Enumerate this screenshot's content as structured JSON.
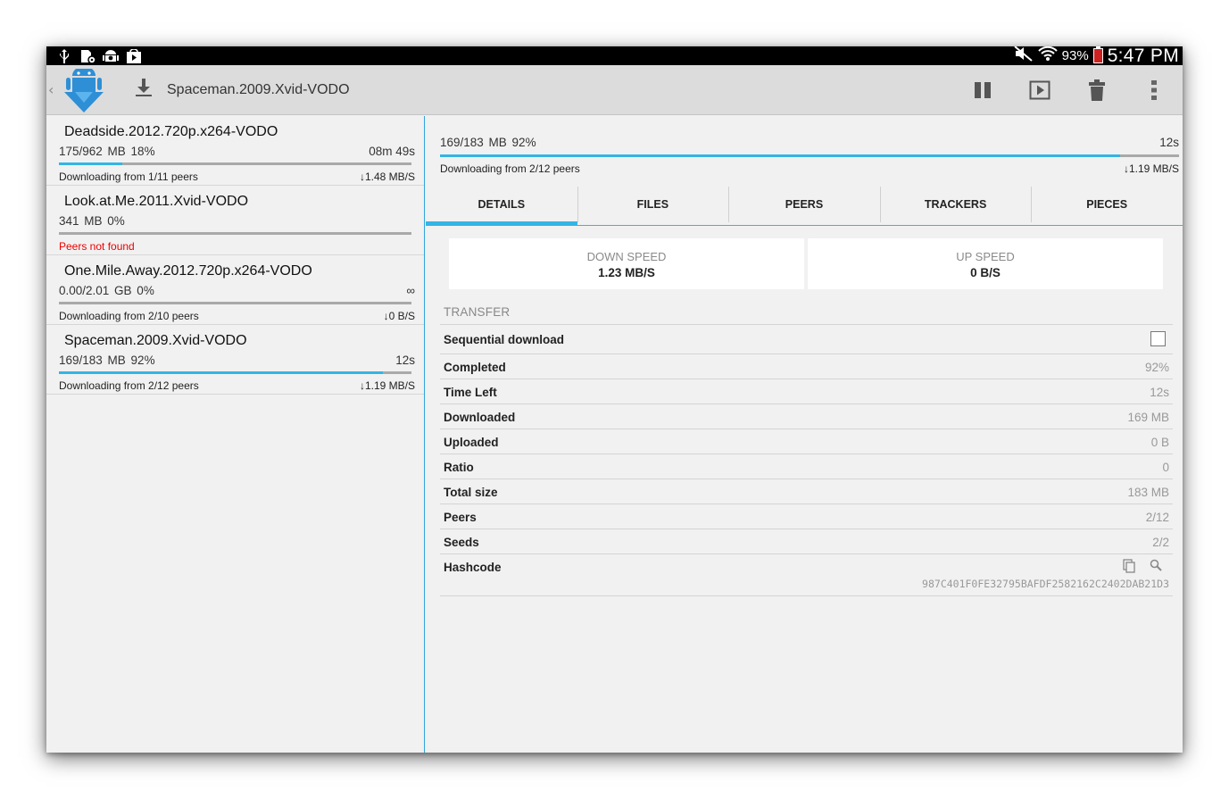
{
  "status_bar": {
    "battery": "93%",
    "time": "5:47 PM",
    "left_icons": [
      "usb-icon",
      "sd-card-icon",
      "android-debug-icon",
      "play-store-icon"
    ],
    "right_icons": [
      "mute-icon",
      "wifi-icon",
      "battery-icon"
    ]
  },
  "action_bar": {
    "title": "Spaceman.2009.Xvid-VODO",
    "actions": [
      "pause",
      "play",
      "delete",
      "overflow-menu"
    ]
  },
  "colors": {
    "accent": "#33b5e5",
    "error": "#ee0000",
    "action_bar": "#dcdcdc"
  },
  "torrents": [
    {
      "name": "Deadside.2012.720p.x264-VODO",
      "size": "175/962 MB   18%",
      "eta": "08m 49s",
      "progress": 0.18,
      "status": "Downloading from 1/11 peers",
      "speed": "1.48 MB/S"
    },
    {
      "name": "Look.at.Me.2011.Xvid-VODO",
      "size": "341 MB   0%",
      "eta": "",
      "progress": 0,
      "status": "Peers not found",
      "speed": ""
    },
    {
      "name": "One.Mile.Away.2012.720p.x264-VODO",
      "size": "0.00/2.01 GB   0%",
      "eta": "∞",
      "progress": 0,
      "status": "Downloading from 2/10 peers",
      "speed": "0 B/S"
    },
    {
      "name": "Spaceman.2009.Xvid-VODO",
      "size": "169/183 MB   92%",
      "eta": "12s",
      "progress": 0.92,
      "status": "Downloading from 2/12 peers",
      "speed": "1.19 MB/S"
    }
  ],
  "detail": {
    "size": "169/183 MB   92%",
    "eta": "12s",
    "progress": 0.92,
    "status": "Downloading from 2/12 peers",
    "speed": "1.19 MB/S",
    "tabs": [
      "DETAILS",
      "FILES",
      "PEERS",
      "TRACKERS",
      "PIECES"
    ],
    "down_speed_label": "DOWN SPEED",
    "down_speed": "1.23 MB/S",
    "up_speed_label": "UP SPEED",
    "up_speed": "0 B/S",
    "section": "TRANSFER",
    "sequential_label": "Sequential download",
    "sequential_checked": false,
    "rows": [
      {
        "label": "Completed",
        "value": "92%"
      },
      {
        "label": "Time Left",
        "value": "12s"
      },
      {
        "label": "Downloaded",
        "value": "169 MB"
      },
      {
        "label": "Uploaded",
        "value": "0 B"
      },
      {
        "label": "Ratio",
        "value": "0"
      },
      {
        "label": "Total size",
        "value": "183 MB"
      },
      {
        "label": "Peers",
        "value": "2/12"
      },
      {
        "label": "Seeds",
        "value": "2/2"
      }
    ],
    "hash_label": "Hashcode",
    "hash": "987C401F0FE32795BAFDF2582162C2402DAB21D3"
  }
}
